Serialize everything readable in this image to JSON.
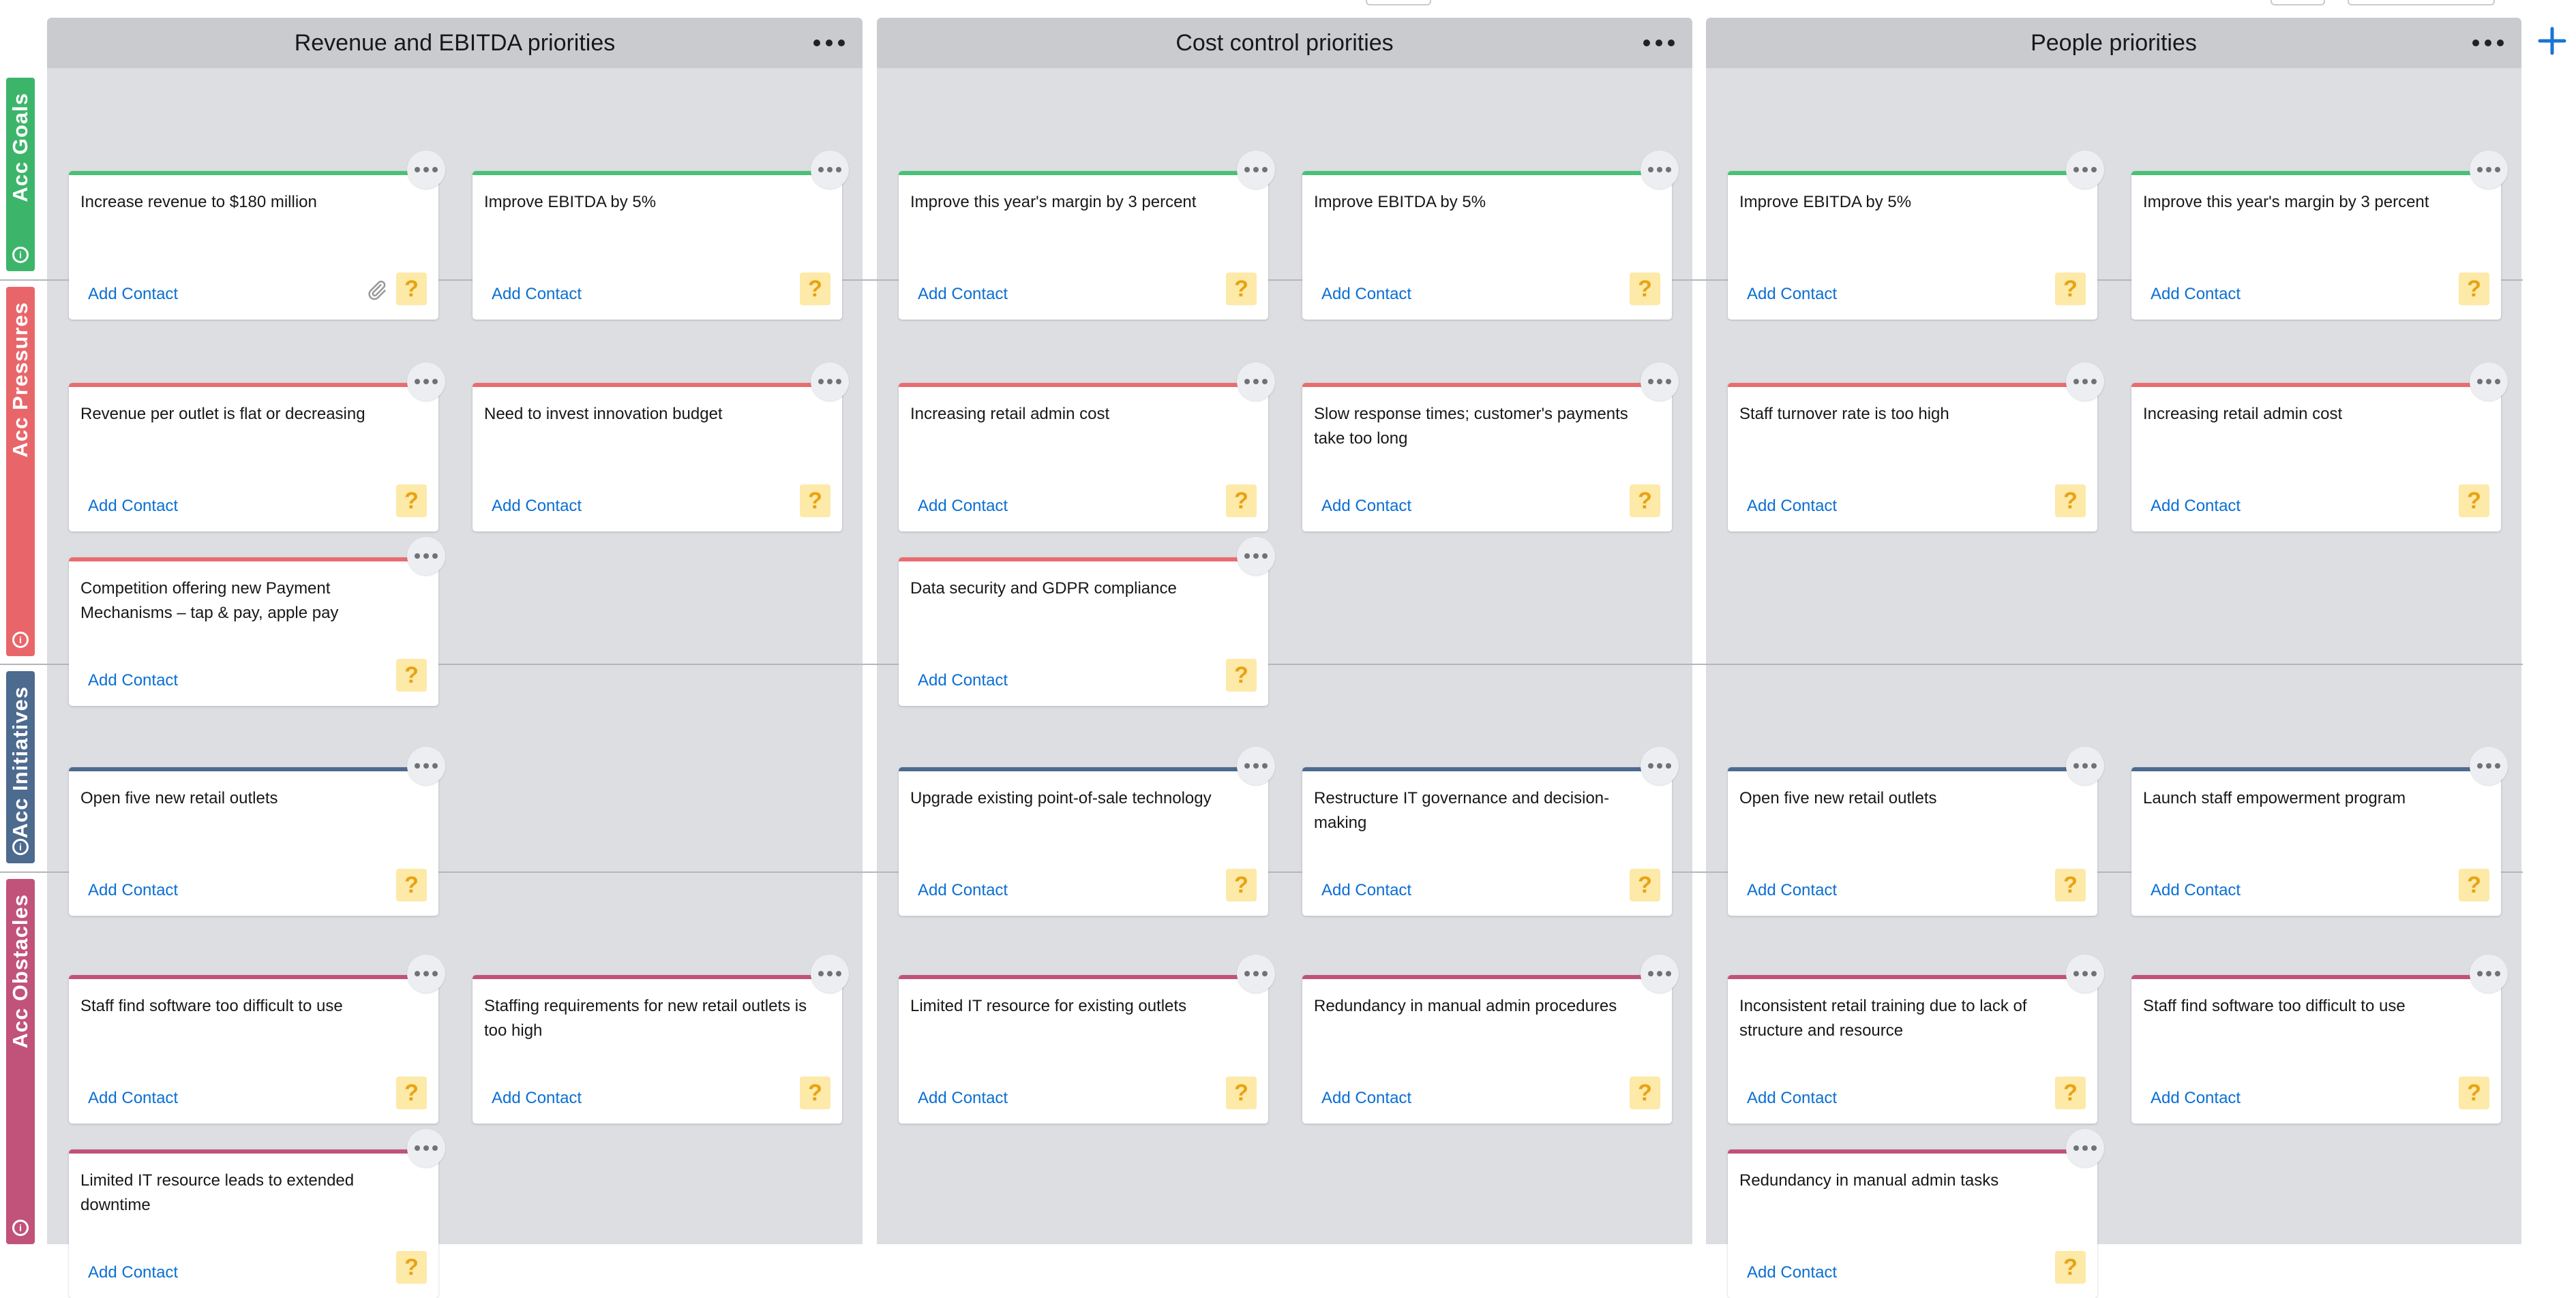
{
  "columns": [
    {
      "title": "Revenue and EBITDA priorities",
      "menu_icon": "ellipsis-icon"
    },
    {
      "title": "Cost control priorities",
      "menu_icon": "ellipsis-icon"
    },
    {
      "title": "People priorities",
      "menu_icon": "ellipsis-icon"
    }
  ],
  "rows": [
    {
      "label": "Acc Goals",
      "color": "#3cb56a",
      "info_icon": "info-icon"
    },
    {
      "label": "Acc Pressures",
      "color": "#e8666a",
      "info_icon": "info-icon"
    },
    {
      "label": "Acc Initiatives",
      "color": "#4d6a8f",
      "info_icon": "info-icon"
    },
    {
      "label": "Acc Obstacles",
      "color": "#c1527a",
      "info_icon": "info-icon"
    }
  ],
  "card_colors": {
    "goal": "#48c274",
    "pressure": "#e86c70",
    "initiative": "#4d6a8f",
    "obstacle": "#c1527a",
    "link": "#0b6fd2",
    "help_bg": "#fde9a8"
  },
  "add_contact_label": "Add Contact",
  "help_glyph": "?",
  "add_column_icon": "plus-icon",
  "cards": [
    {
      "row": 0,
      "col": 0,
      "slot": 0,
      "line": 0,
      "text": "Increase revenue to $180 million",
      "attachment": true
    },
    {
      "row": 0,
      "col": 0,
      "slot": 1,
      "line": 0,
      "text": "Improve EBITDA by 5%"
    },
    {
      "row": 0,
      "col": 1,
      "slot": 0,
      "line": 0,
      "text": "Improve this year's margin by 3 percent"
    },
    {
      "row": 0,
      "col": 1,
      "slot": 1,
      "line": 0,
      "text": "Improve EBITDA by 5%"
    },
    {
      "row": 0,
      "col": 2,
      "slot": 0,
      "line": 0,
      "text": "Improve EBITDA by 5%"
    },
    {
      "row": 0,
      "col": 2,
      "slot": 1,
      "line": 0,
      "text": "Improve this year's margin by 3 percent"
    },
    {
      "row": 1,
      "col": 0,
      "slot": 0,
      "line": 0,
      "text": "Revenue per outlet is flat or decreasing"
    },
    {
      "row": 1,
      "col": 0,
      "slot": 1,
      "line": 0,
      "text": "Need to invest innovation budget"
    },
    {
      "row": 1,
      "col": 0,
      "slot": 0,
      "line": 1,
      "text": "Competition offering new Payment Mechanisms – tap & pay, apple pay"
    },
    {
      "row": 1,
      "col": 1,
      "slot": 0,
      "line": 0,
      "text": "Increasing retail admin cost"
    },
    {
      "row": 1,
      "col": 1,
      "slot": 1,
      "line": 0,
      "text": "Slow response times; customer's payments take too long"
    },
    {
      "row": 1,
      "col": 1,
      "slot": 0,
      "line": 1,
      "text": "Data security and GDPR compliance"
    },
    {
      "row": 1,
      "col": 2,
      "slot": 0,
      "line": 0,
      "text": "Staff turnover rate is too high"
    },
    {
      "row": 1,
      "col": 2,
      "slot": 1,
      "line": 0,
      "text": "Increasing retail admin cost"
    },
    {
      "row": 2,
      "col": 0,
      "slot": 0,
      "line": 0,
      "text": "Open five new retail outlets"
    },
    {
      "row": 2,
      "col": 1,
      "slot": 0,
      "line": 0,
      "text": "Upgrade existing point-of-sale technology"
    },
    {
      "row": 2,
      "col": 1,
      "slot": 1,
      "line": 0,
      "text": "Restructure IT governance and decision-making"
    },
    {
      "row": 2,
      "col": 2,
      "slot": 0,
      "line": 0,
      "text": "Open five new retail outlets"
    },
    {
      "row": 2,
      "col": 2,
      "slot": 1,
      "line": 0,
      "text": "Launch staff empowerment program"
    },
    {
      "row": 3,
      "col": 0,
      "slot": 0,
      "line": 0,
      "text": "Staff find software too difficult to use"
    },
    {
      "row": 3,
      "col": 0,
      "slot": 1,
      "line": 0,
      "text": "Staffing requirements for new retail outlets is too high"
    },
    {
      "row": 3,
      "col": 0,
      "slot": 0,
      "line": 1,
      "text": "Limited IT resource leads to extended downtime"
    },
    {
      "row": 3,
      "col": 1,
      "slot": 0,
      "line": 0,
      "text": "Limited IT resource for existing outlets"
    },
    {
      "row": 3,
      "col": 1,
      "slot": 1,
      "line": 0,
      "text": "Redundancy in manual admin procedures"
    },
    {
      "row": 3,
      "col": 2,
      "slot": 0,
      "line": 0,
      "text": "Inconsistent retail training due to lack of structure and resource"
    },
    {
      "row": 3,
      "col": 2,
      "slot": 1,
      "line": 0,
      "text": "Staff find software too difficult to use"
    },
    {
      "row": 3,
      "col": 2,
      "slot": 0,
      "line": 1,
      "text": "Redundancy in manual admin tasks"
    }
  ]
}
